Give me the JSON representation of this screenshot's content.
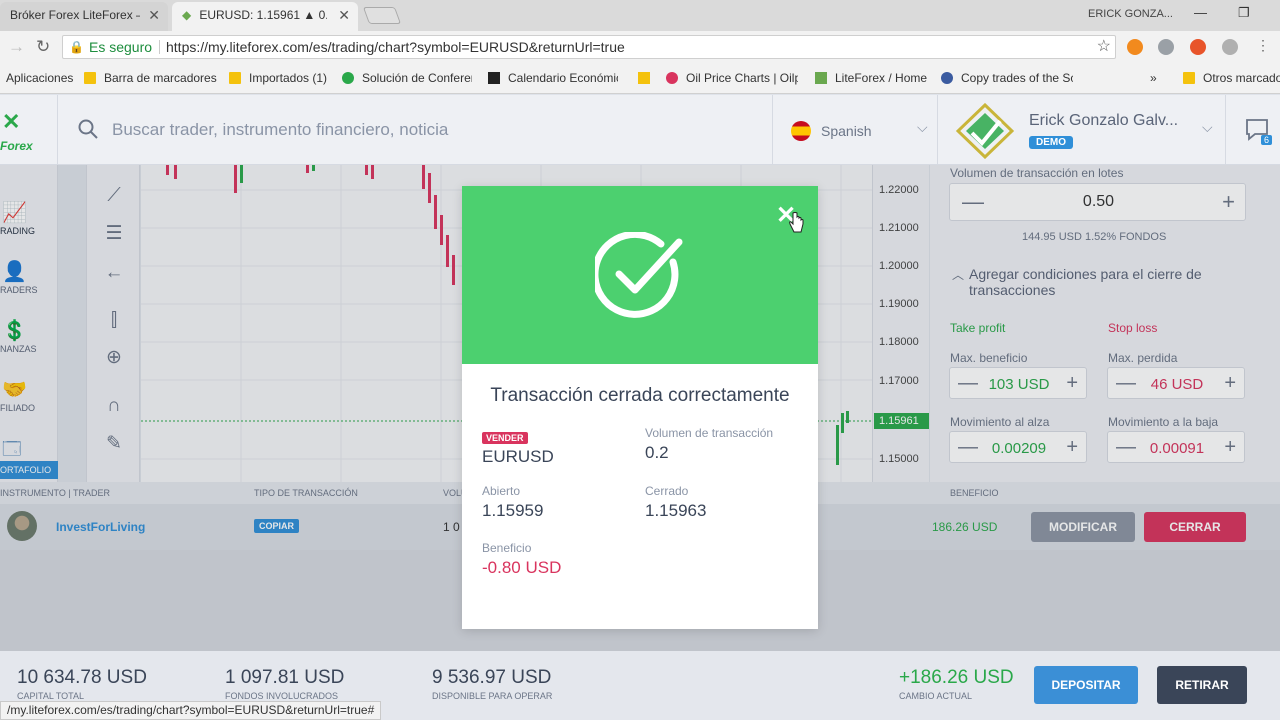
{
  "browser": {
    "tabs": [
      {
        "title": "Bróker Forex LiteForex – O"
      },
      {
        "title": "EURUSD: 1.15961 ▲ 0.22"
      }
    ],
    "window_user": "ERICK GONZA...",
    "secure_label": "Es seguro",
    "url": "https://my.liteforex.com/es/trading/chart?symbol=EURUSD&returnUrl=true",
    "status_url": "/my.liteforex.com/es/trading/chart?symbol=EURUSD&returnUrl=true#",
    "bookmarks": [
      "Aplicaciones",
      "Barra de marcadores",
      "Importados (1)",
      "Solución de Conferen",
      "Calendario Económic",
      "Oil Price Charts | Oilp",
      "LiteForex / Home",
      "Copy trades of the Sc",
      "Otros marcado"
    ],
    "overflow": "»"
  },
  "header": {
    "logo_text": "Forex",
    "search_placeholder": "Buscar trader, instrumento financiero, noticia",
    "language": "Spanish",
    "user_name": "Erick Gonzalo Galv...",
    "account_type": "DEMO",
    "chat_count": "6"
  },
  "nav": {
    "items": [
      {
        "label": "RADING"
      },
      {
        "label": "RADERS"
      },
      {
        "label": "NANZAS"
      },
      {
        "label": "FILIADO"
      }
    ],
    "portfolio": "ORTAFOLIO"
  },
  "chart": {
    "price_ticks": [
      "1.22000",
      "1.21000",
      "1.20000",
      "1.19000",
      "1.18000",
      "1.17000",
      "1.15000"
    ],
    "current_price": "1.15961"
  },
  "order_panel": {
    "volume_label": "Volumen de transacción en lotes",
    "volume_value": "0.50",
    "funds_text": "144.95 USD  1.52% FONDOS",
    "conditions_label": "Agregar condiciones para el cierre de transacciones",
    "take_profit_label": "Take profit",
    "stop_loss_label": "Stop loss",
    "max_profit_label": "Max. beneficio",
    "max_profit_value": "103 USD",
    "max_loss_label": "Max. perdida",
    "max_loss_value": "46 USD",
    "move_up_label": "Movimiento al alza",
    "move_up_value": "0.00209",
    "move_down_label": "Movimiento a la baja",
    "move_down_value": "0.00091"
  },
  "table": {
    "headers": {
      "instrument": "INSTRUMENTO | TRADER",
      "type": "TIPO DE TRANSACCIÓN",
      "volume": "VOLU",
      "profit": "BENEFICIO"
    },
    "row": {
      "trader": "InvestForLiving",
      "badge": "COPIAR",
      "volume": "1 0",
      "profit": "186.26 USD",
      "modify": "MODIFICAR",
      "close": "CERRAR"
    }
  },
  "footer": {
    "capital_value": "10 634.78 USD",
    "capital_label": "CAPITAL TOTAL",
    "funds_value": "1 097.81 USD",
    "funds_label": "FONDOS INVOLUCRADOS",
    "available_value": "9 536.97 USD",
    "available_label": "DISPONIBLE PARA OPERAR",
    "change_value": "+186.26 USD",
    "change_label": "CAMBIO ACTUAL",
    "deposit": "DEPOSITAR",
    "withdraw": "RETIRAR"
  },
  "modal": {
    "title": "Transacción cerrada correctamente",
    "side_badge": "VENDER",
    "instrument": "EURUSD",
    "volume_label": "Volumen de transacción",
    "volume": "0.2",
    "opened_label": "Abierto",
    "opened": "1.15959",
    "closed_label": "Cerrado",
    "closed": "1.15963",
    "profit_label": "Beneficio",
    "profit": "-0.80 USD"
  },
  "colors": {
    "success": "#4cd06f",
    "accent": "#2f8fd8",
    "danger": "#d9345e",
    "profit": "#2aa84a"
  }
}
